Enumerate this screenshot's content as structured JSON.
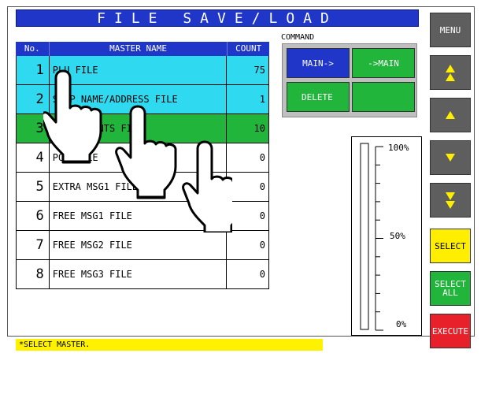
{
  "title": "FILE SAVE/LOAD",
  "table": {
    "headers": {
      "no": "No.",
      "name": "MASTER NAME",
      "count": "COUNT"
    },
    "rows": [
      {
        "no": "1",
        "name": "PLU FILE",
        "count": "75",
        "state": "cyan"
      },
      {
        "no": "2",
        "name": "SHOP NAME/ADDRESS FILE",
        "count": "1",
        "state": "cyan"
      },
      {
        "no": "3",
        "name": "INGREDIENTS FILE",
        "count": "10",
        "state": "green"
      },
      {
        "no": "4",
        "name": "POP FILE",
        "count": "0",
        "state": "white"
      },
      {
        "no": "5",
        "name": "EXTRA MSG1 FILE",
        "count": "0",
        "state": "white"
      },
      {
        "no": "6",
        "name": "FREE MSG1 FILE",
        "count": "0",
        "state": "white"
      },
      {
        "no": "7",
        "name": "FREE MSG2 FILE",
        "count": "0",
        "state": "white"
      },
      {
        "no": "8",
        "name": "FREE MSG3 FILE",
        "count": "0",
        "state": "white"
      }
    ]
  },
  "command": {
    "label": "COMMAND",
    "main_to": "MAIN->",
    "to_main": "->MAIN",
    "delete": "DELETE"
  },
  "progress": {
    "top_label": "100%",
    "mid_label": "50%",
    "bottom_label": "0%",
    "value": 0
  },
  "side": {
    "menu": "MENU",
    "select": "SELECT",
    "select_all_1": "SELECT",
    "select_all_2": "ALL",
    "execute": "EXECUTE",
    "icons": [
      "page-up-icon",
      "up-icon",
      "down-icon",
      "page-down-icon"
    ]
  },
  "status": "*SELECT MASTER.",
  "colors": {
    "title_bg": "#1f36c9",
    "row_selected": "#2fd9ef",
    "row_active": "#22b53c",
    "command_blue": "#1f36c9",
    "command_green": "#22b53c",
    "select": "#ffee00",
    "execute": "#e8202a",
    "status_bg": "#fff200"
  }
}
